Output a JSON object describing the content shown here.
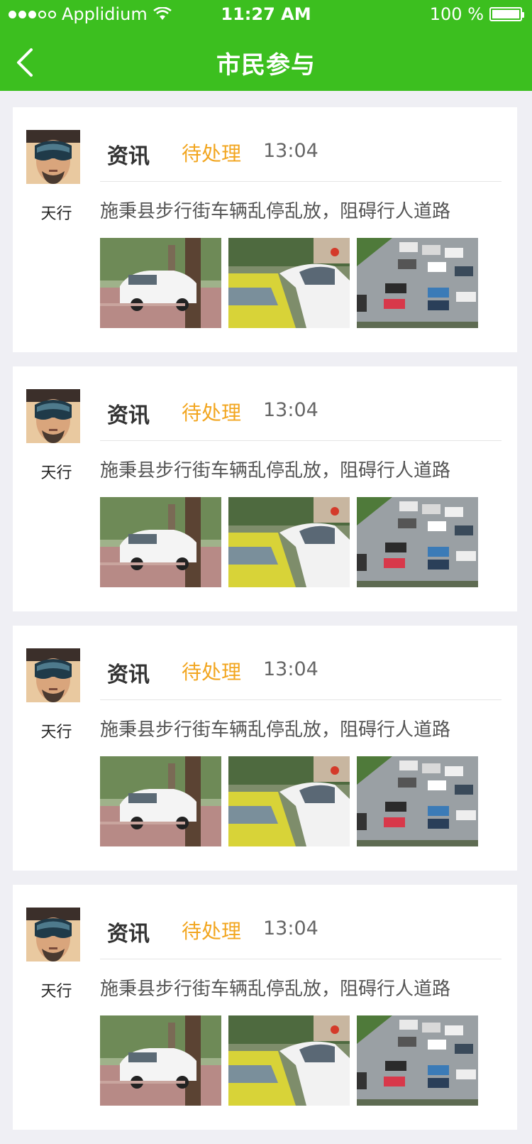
{
  "status": {
    "carrier": "Applidium",
    "time": "11:27 AM",
    "battery": "100 %"
  },
  "nav": {
    "title": "市民参与",
    "back_icon": "chevron-left-icon"
  },
  "colors": {
    "header": "#3cbf1f",
    "pending": "#f2a620",
    "background": "#efeff4"
  },
  "items": [
    {
      "user": "天行",
      "type": "资讯",
      "state": "待处理",
      "time": "13:04",
      "desc": "施秉县步行街车辆乱停乱放，阻碍行人道路",
      "photos": [
        "sidewalk-parked-car-photo",
        "street-taxi-traffic-photo",
        "parking-lot-aerial-photo"
      ]
    },
    {
      "user": "天行",
      "type": "资讯",
      "state": "待处理",
      "time": "13:04",
      "desc": "施秉县步行街车辆乱停乱放，阻碍行人道路",
      "photos": [
        "sidewalk-parked-car-photo",
        "street-taxi-traffic-photo",
        "parking-lot-aerial-photo"
      ]
    },
    {
      "user": "天行",
      "type": "资讯",
      "state": "待处理",
      "time": "13:04",
      "desc": "施秉县步行街车辆乱停乱放，阻碍行人道路",
      "photos": [
        "sidewalk-parked-car-photo",
        "street-taxi-traffic-photo",
        "parking-lot-aerial-photo"
      ]
    },
    {
      "user": "天行",
      "type": "资讯",
      "state": "待处理",
      "time": "13:04",
      "desc": "施秉县步行街车辆乱停乱放，阻碍行人道路",
      "photos": [
        "sidewalk-parked-car-photo",
        "street-taxi-traffic-photo",
        "parking-lot-aerial-photo"
      ]
    }
  ]
}
